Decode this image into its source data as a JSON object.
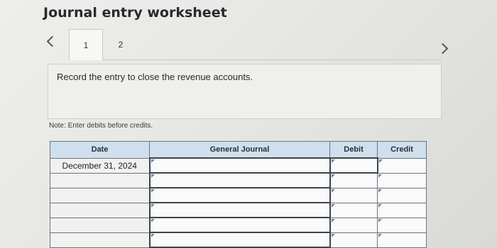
{
  "header": {
    "title": "Journal entry worksheet"
  },
  "tabs": [
    {
      "label": "1",
      "active": true
    },
    {
      "label": "2",
      "active": false
    }
  ],
  "instruction": "Record the entry to close the revenue accounts.",
  "note": "Note: Enter debits before credits.",
  "journal": {
    "columns": [
      "Date",
      "General Journal",
      "Debit",
      "Credit"
    ],
    "rows": [
      {
        "date": "December 31, 2024",
        "account": "",
        "debit": "",
        "credit": ""
      },
      {
        "date": "",
        "account": "",
        "debit": "",
        "credit": ""
      },
      {
        "date": "",
        "account": "",
        "debit": "",
        "credit": ""
      },
      {
        "date": "",
        "account": "",
        "debit": "",
        "credit": ""
      },
      {
        "date": "",
        "account": "",
        "debit": "",
        "credit": ""
      },
      {
        "date": "",
        "account": "",
        "debit": "",
        "credit": ""
      }
    ]
  },
  "colors": {
    "header_bg": "#cfdfee",
    "accent": "#6a88a8"
  }
}
